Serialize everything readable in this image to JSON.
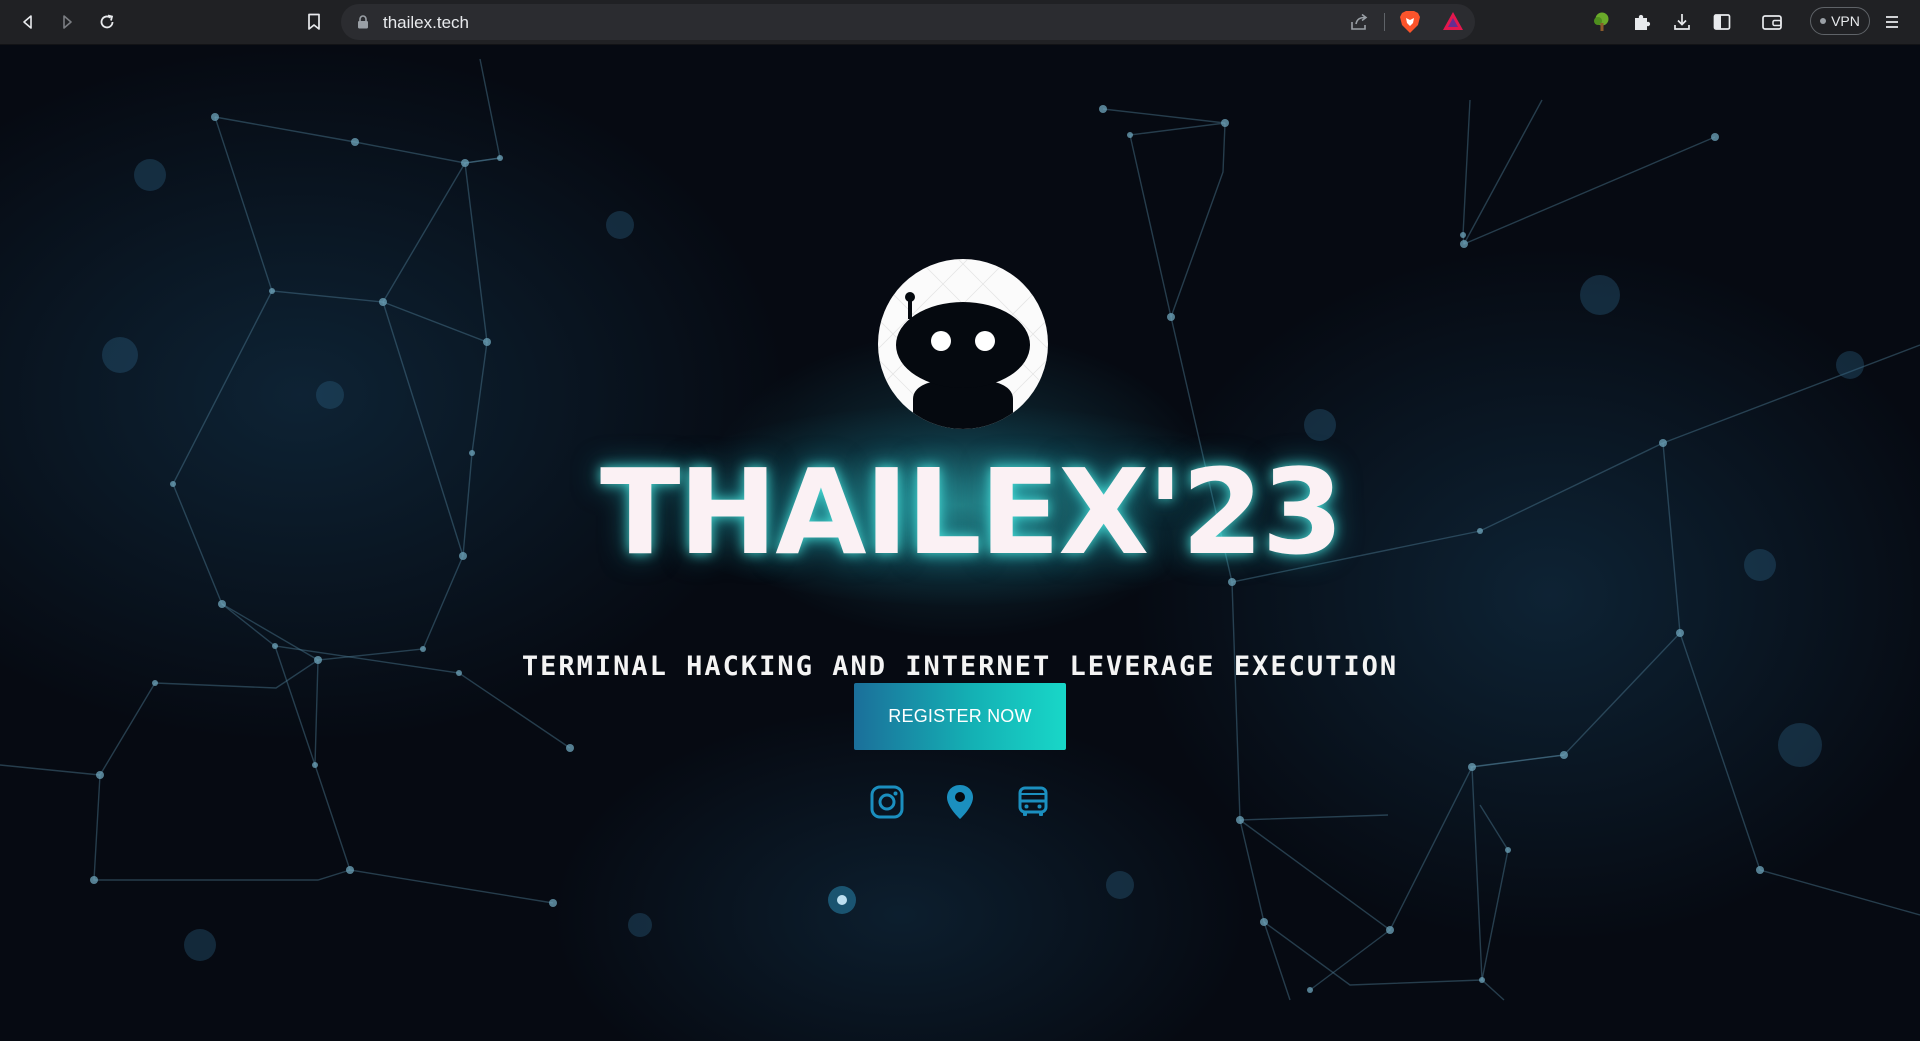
{
  "browser": {
    "url": "thailex.tech",
    "vpn_label": "VPN",
    "icons": {
      "back": "back-arrow-icon",
      "forward": "forward-arrow-icon",
      "reload": "reload-icon",
      "bookmark": "bookmark-icon",
      "lock": "lock-icon",
      "share": "share-icon",
      "brave_shields": "brave-shields-icon",
      "brave_rewards": "brave-rewards-icon",
      "extension_tree": "tree-extension-icon",
      "extensions": "puzzle-icon",
      "downloads": "download-icon",
      "sidebar": "sidebar-icon",
      "wallet": "wallet-icon",
      "menu": "hamburger-menu-icon"
    }
  },
  "hero": {
    "logo": "robot-head-logo",
    "title": "THAILEX'23",
    "tagline": "Terminal Hacking and Internet Leverage Execution",
    "register_label": "REGISTER NOW"
  },
  "social": {
    "instagram": "instagram-icon",
    "location": "map-pin-icon",
    "transport": "bus-icon"
  },
  "colors": {
    "background": "#060a12",
    "accent": "#18c7c8",
    "social_icon": "#1b8fbf",
    "title_glow": "#50f0e6"
  }
}
